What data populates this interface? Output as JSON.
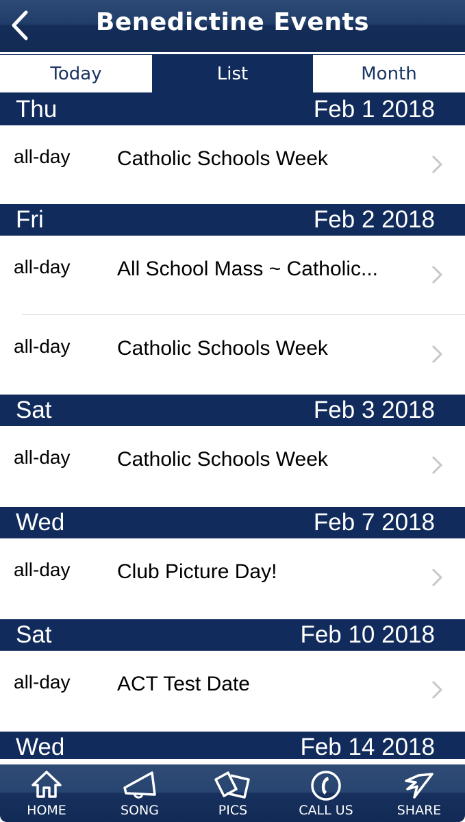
{
  "header": {
    "title": "Benedictine Events",
    "back_icon": "chevron-left-icon"
  },
  "tabs": [
    {
      "label": "Today",
      "active": false
    },
    {
      "label": "List",
      "active": true
    },
    {
      "label": "Month",
      "active": false
    }
  ],
  "sections": [
    {
      "day": "Thu",
      "date": "Feb 1 2018",
      "events": [
        {
          "time": "all-day",
          "title": "Catholic Schools Week"
        }
      ]
    },
    {
      "day": "Fri",
      "date": "Feb 2 2018",
      "events": [
        {
          "time": "all-day",
          "title": "All School Mass ~ Catholic..."
        },
        {
          "time": "all-day",
          "title": "Catholic Schools Week"
        }
      ]
    },
    {
      "day": "Sat",
      "date": "Feb 3 2018",
      "events": [
        {
          "time": "all-day",
          "title": "Catholic Schools Week"
        }
      ]
    },
    {
      "day": "Wed",
      "date": "Feb 7 2018",
      "events": [
        {
          "time": "all-day",
          "title": "Club Picture Day!"
        }
      ]
    },
    {
      "day": "Sat",
      "date": "Feb 10 2018",
      "events": [
        {
          "time": "all-day",
          "title": "ACT Test Date"
        }
      ]
    },
    {
      "day": "Wed",
      "date": "Feb 14 2018",
      "events": []
    }
  ],
  "tabbar": [
    {
      "label": "HOME",
      "icon": "home-icon"
    },
    {
      "label": "SONG",
      "icon": "megaphone-icon"
    },
    {
      "label": "PICS",
      "icon": "photos-icon"
    },
    {
      "label": "CALL US",
      "icon": "phone-icon"
    },
    {
      "label": "SHARE",
      "icon": "share-arrow-icon"
    }
  ],
  "colors": {
    "navy": "#112c5c",
    "tab_text": "#1a3463",
    "chevron": "#c7c7cc"
  }
}
